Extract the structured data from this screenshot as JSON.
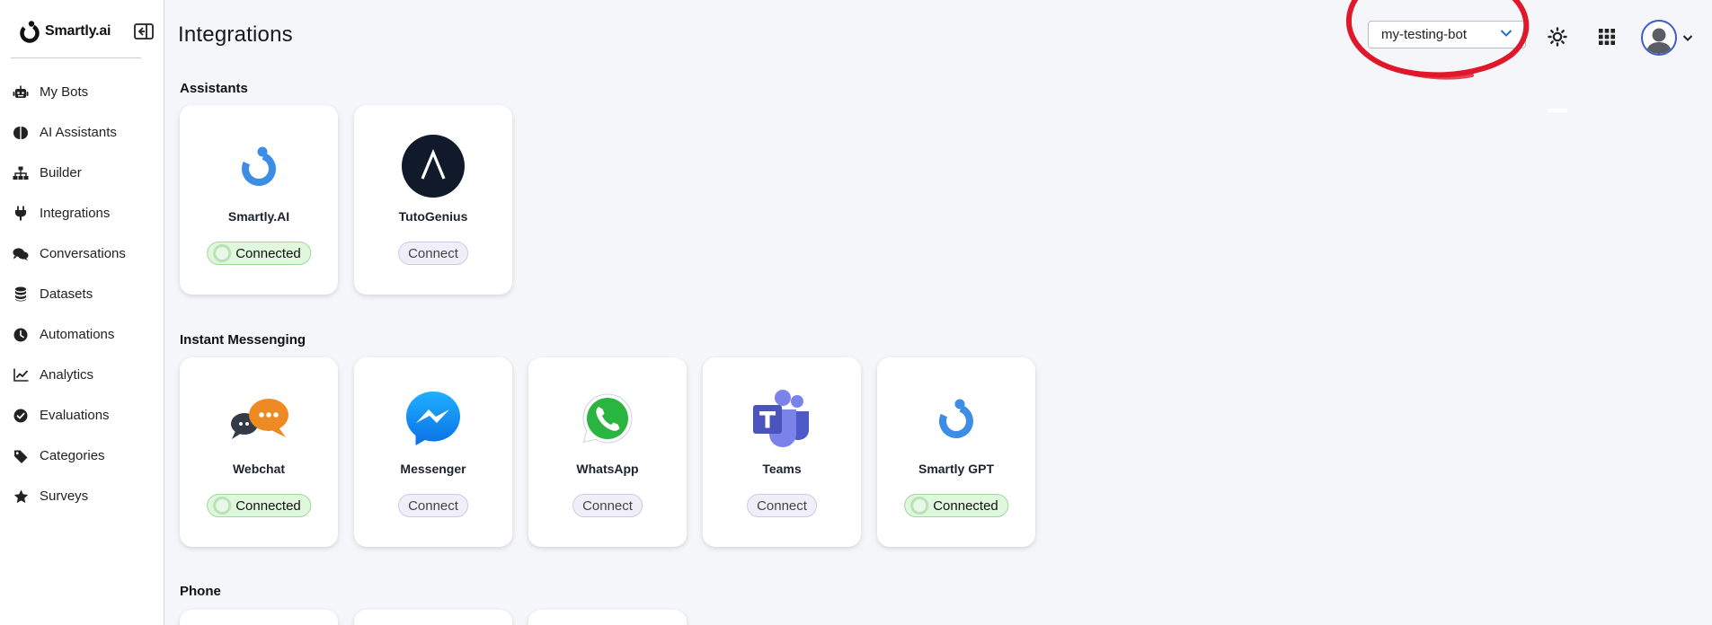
{
  "brand": {
    "name": "Smartly.ai"
  },
  "sidebar": {
    "items": [
      {
        "label": "My Bots",
        "icon": "robot-icon"
      },
      {
        "label": "AI Assistants",
        "icon": "brain-icon"
      },
      {
        "label": "Builder",
        "icon": "sitemap-icon"
      },
      {
        "label": "Integrations",
        "icon": "plug-icon"
      },
      {
        "label": "Conversations",
        "icon": "comments-icon"
      },
      {
        "label": "Datasets",
        "icon": "database-icon"
      },
      {
        "label": "Automations",
        "icon": "clock-icon"
      },
      {
        "label": "Analytics",
        "icon": "chart-line-icon"
      },
      {
        "label": "Evaluations",
        "icon": "check-circle-icon"
      },
      {
        "label": "Categories",
        "icon": "tags-icon"
      },
      {
        "label": "Surveys",
        "icon": "star-icon"
      }
    ]
  },
  "header": {
    "title": "Integrations",
    "bot_selector": {
      "value": "my-testing-bot"
    },
    "colors": {
      "accent": "#1a73c9",
      "annotation": "#e0182b"
    }
  },
  "sections": [
    {
      "title": "Assistants",
      "cards": [
        {
          "name": "Smartly.AI",
          "status": "Connected",
          "icon": "smartly-logo-icon"
        },
        {
          "name": "TutoGenius",
          "status": "Connect",
          "icon": "tutogenius-logo-icon"
        }
      ]
    },
    {
      "title": "Instant Messenging",
      "cards": [
        {
          "name": "Webchat",
          "status": "Connected",
          "icon": "webchat-logo-icon"
        },
        {
          "name": "Messenger",
          "status": "Connect",
          "icon": "messenger-logo-icon"
        },
        {
          "name": "WhatsApp",
          "status": "Connect",
          "icon": "whatsapp-logo-icon"
        },
        {
          "name": "Teams",
          "status": "Connect",
          "icon": "teams-logo-icon"
        },
        {
          "name": "Smartly GPT",
          "status": "Connected",
          "icon": "smartly-logo-icon"
        }
      ]
    },
    {
      "title": "Phone",
      "cards": []
    }
  ]
}
